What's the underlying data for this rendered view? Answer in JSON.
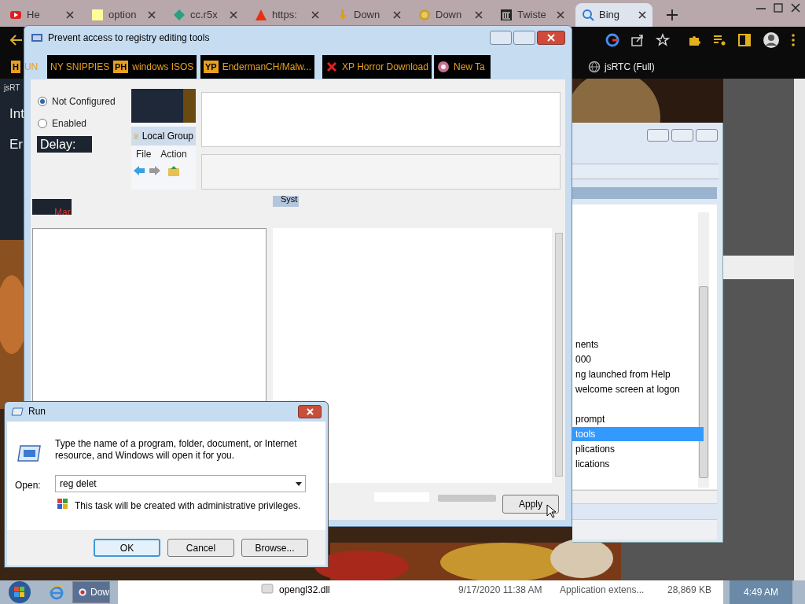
{
  "browser": {
    "tabs": [
      {
        "label": "He",
        "kind": "youtube",
        "selected": false
      },
      {
        "label": "option",
        "kind": "note",
        "selected": false
      },
      {
        "label": "cc.r5x",
        "kind": "diamond",
        "selected": false
      },
      {
        "label": "https:",
        "kind": "warning",
        "selected": false
      },
      {
        "label": "Down",
        "kind": "download",
        "selected": false
      },
      {
        "label": "Down",
        "kind": "coin",
        "selected": false
      },
      {
        "label": "Twiste",
        "kind": "building",
        "selected": false
      },
      {
        "label": "Bing",
        "kind": "search",
        "selected": true
      }
    ],
    "bookmarks": [
      {
        "label": "UN",
        "badge": "H"
      },
      {
        "label": "NY SNIPPIES"
      },
      {
        "label": "windows ISOS",
        "badge": "PH"
      },
      {
        "label": "EndermanCH/Malw...",
        "badge": "YP"
      },
      {
        "label": "XP Horror Download",
        "kind": "x"
      },
      {
        "label": "New Ta",
        "kind": "disc"
      },
      {
        "label": "jsRTC (Full)",
        "kind": "globe"
      }
    ],
    "page_texts": [
      "jsRT",
      "Int",
      "Er",
      "Delay:",
      "Mar"
    ]
  },
  "policy_dialog": {
    "title": "Prevent access to registry editing tools",
    "options": [
      {
        "label": "Not Configured",
        "selected": true
      },
      {
        "label": "Enabled",
        "selected": false
      }
    ],
    "fragment": {
      "title": "Local Group",
      "menu": [
        "File",
        "Action"
      ]
    },
    "column_fragment": "Syst",
    "apply_button": "Apply"
  },
  "editor_window": {
    "items": [
      {
        "label": "nents",
        "selected": false
      },
      {
        "label": "000",
        "selected": false
      },
      {
        "label": "ng launched from Help",
        "selected": false
      },
      {
        "label": "welcome screen at logon",
        "selected": false
      },
      {
        "label": "prompt",
        "selected": false
      },
      {
        "label": "tools",
        "selected": true
      },
      {
        "label": "plications",
        "selected": false
      },
      {
        "label": "lications",
        "selected": false
      }
    ]
  },
  "run_dialog": {
    "title": "Run",
    "description": "Type the name of a program, folder, document, or Internet resource, and Windows will open it for you.",
    "open_label": "Open:",
    "value": "reg delet",
    "admin_note": "This task will be created with administrative privileges.",
    "buttons": [
      {
        "label": "OK",
        "default": true
      },
      {
        "label": "Cancel",
        "default": false
      },
      {
        "label": "Browse...",
        "default": false
      }
    ]
  },
  "taskbar": {
    "button": "Dow",
    "clock": "4:49 AM"
  },
  "explorer_row": {
    "name": "opengl32.dll",
    "date": "9/17/2020 11:38 AM",
    "type": "Application extens...",
    "size": "28,869 KB"
  }
}
